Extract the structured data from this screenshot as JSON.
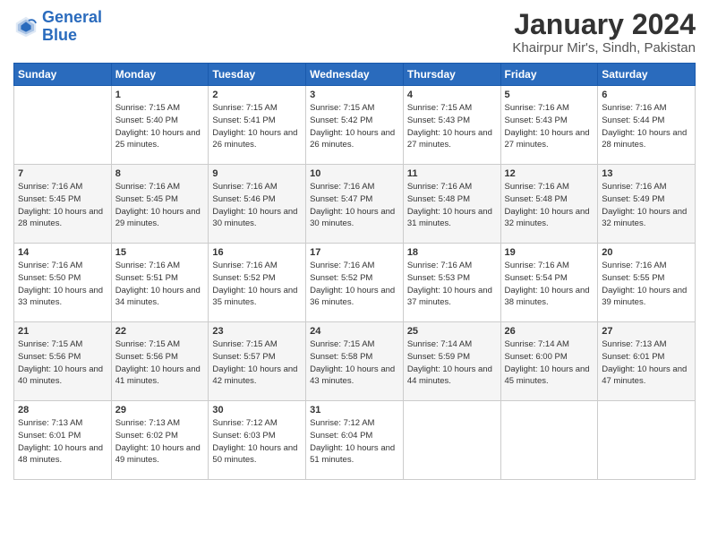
{
  "header": {
    "logo_line1": "General",
    "logo_line2": "Blue",
    "month": "January 2024",
    "location": "Khairpur Mir's, Sindh, Pakistan"
  },
  "weekdays": [
    "Sunday",
    "Monday",
    "Tuesday",
    "Wednesday",
    "Thursday",
    "Friday",
    "Saturday"
  ],
  "weeks": [
    [
      {
        "day": "",
        "info": ""
      },
      {
        "day": "1",
        "info": "Sunrise: 7:15 AM\nSunset: 5:40 PM\nDaylight: 10 hours\nand 25 minutes."
      },
      {
        "day": "2",
        "info": "Sunrise: 7:15 AM\nSunset: 5:41 PM\nDaylight: 10 hours\nand 26 minutes."
      },
      {
        "day": "3",
        "info": "Sunrise: 7:15 AM\nSunset: 5:42 PM\nDaylight: 10 hours\nand 26 minutes."
      },
      {
        "day": "4",
        "info": "Sunrise: 7:15 AM\nSunset: 5:43 PM\nDaylight: 10 hours\nand 27 minutes."
      },
      {
        "day": "5",
        "info": "Sunrise: 7:16 AM\nSunset: 5:43 PM\nDaylight: 10 hours\nand 27 minutes."
      },
      {
        "day": "6",
        "info": "Sunrise: 7:16 AM\nSunset: 5:44 PM\nDaylight: 10 hours\nand 28 minutes."
      }
    ],
    [
      {
        "day": "7",
        "info": "Sunrise: 7:16 AM\nSunset: 5:45 PM\nDaylight: 10 hours\nand 28 minutes."
      },
      {
        "day": "8",
        "info": "Sunrise: 7:16 AM\nSunset: 5:45 PM\nDaylight: 10 hours\nand 29 minutes."
      },
      {
        "day": "9",
        "info": "Sunrise: 7:16 AM\nSunset: 5:46 PM\nDaylight: 10 hours\nand 30 minutes."
      },
      {
        "day": "10",
        "info": "Sunrise: 7:16 AM\nSunset: 5:47 PM\nDaylight: 10 hours\nand 30 minutes."
      },
      {
        "day": "11",
        "info": "Sunrise: 7:16 AM\nSunset: 5:48 PM\nDaylight: 10 hours\nand 31 minutes."
      },
      {
        "day": "12",
        "info": "Sunrise: 7:16 AM\nSunset: 5:48 PM\nDaylight: 10 hours\nand 32 minutes."
      },
      {
        "day": "13",
        "info": "Sunrise: 7:16 AM\nSunset: 5:49 PM\nDaylight: 10 hours\nand 32 minutes."
      }
    ],
    [
      {
        "day": "14",
        "info": "Sunrise: 7:16 AM\nSunset: 5:50 PM\nDaylight: 10 hours\nand 33 minutes."
      },
      {
        "day": "15",
        "info": "Sunrise: 7:16 AM\nSunset: 5:51 PM\nDaylight: 10 hours\nand 34 minutes."
      },
      {
        "day": "16",
        "info": "Sunrise: 7:16 AM\nSunset: 5:52 PM\nDaylight: 10 hours\nand 35 minutes."
      },
      {
        "day": "17",
        "info": "Sunrise: 7:16 AM\nSunset: 5:52 PM\nDaylight: 10 hours\nand 36 minutes."
      },
      {
        "day": "18",
        "info": "Sunrise: 7:16 AM\nSunset: 5:53 PM\nDaylight: 10 hours\nand 37 minutes."
      },
      {
        "day": "19",
        "info": "Sunrise: 7:16 AM\nSunset: 5:54 PM\nDaylight: 10 hours\nand 38 minutes."
      },
      {
        "day": "20",
        "info": "Sunrise: 7:16 AM\nSunset: 5:55 PM\nDaylight: 10 hours\nand 39 minutes."
      }
    ],
    [
      {
        "day": "21",
        "info": "Sunrise: 7:15 AM\nSunset: 5:56 PM\nDaylight: 10 hours\nand 40 minutes."
      },
      {
        "day": "22",
        "info": "Sunrise: 7:15 AM\nSunset: 5:56 PM\nDaylight: 10 hours\nand 41 minutes."
      },
      {
        "day": "23",
        "info": "Sunrise: 7:15 AM\nSunset: 5:57 PM\nDaylight: 10 hours\nand 42 minutes."
      },
      {
        "day": "24",
        "info": "Sunrise: 7:15 AM\nSunset: 5:58 PM\nDaylight: 10 hours\nand 43 minutes."
      },
      {
        "day": "25",
        "info": "Sunrise: 7:14 AM\nSunset: 5:59 PM\nDaylight: 10 hours\nand 44 minutes."
      },
      {
        "day": "26",
        "info": "Sunrise: 7:14 AM\nSunset: 6:00 PM\nDaylight: 10 hours\nand 45 minutes."
      },
      {
        "day": "27",
        "info": "Sunrise: 7:13 AM\nSunset: 6:01 PM\nDaylight: 10 hours\nand 47 minutes."
      }
    ],
    [
      {
        "day": "28",
        "info": "Sunrise: 7:13 AM\nSunset: 6:01 PM\nDaylight: 10 hours\nand 48 minutes."
      },
      {
        "day": "29",
        "info": "Sunrise: 7:13 AM\nSunset: 6:02 PM\nDaylight: 10 hours\nand 49 minutes."
      },
      {
        "day": "30",
        "info": "Sunrise: 7:12 AM\nSunset: 6:03 PM\nDaylight: 10 hours\nand 50 minutes."
      },
      {
        "day": "31",
        "info": "Sunrise: 7:12 AM\nSunset: 6:04 PM\nDaylight: 10 hours\nand 51 minutes."
      },
      {
        "day": "",
        "info": ""
      },
      {
        "day": "",
        "info": ""
      },
      {
        "day": "",
        "info": ""
      }
    ]
  ]
}
